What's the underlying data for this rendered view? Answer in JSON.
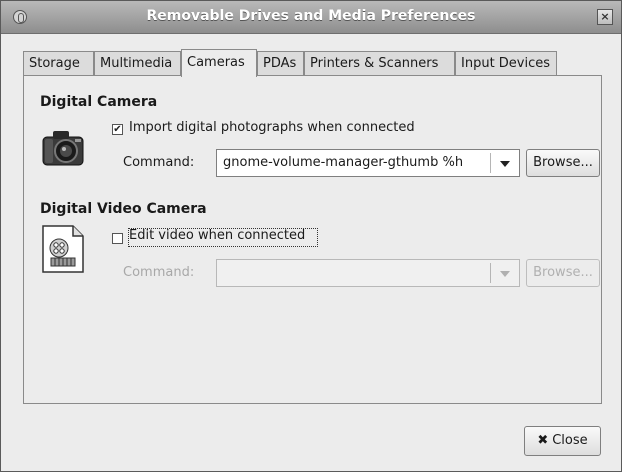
{
  "window": {
    "title": "Removable Drives and Media Preferences",
    "close_glyph": "×"
  },
  "tabs": [
    {
      "label": "Storage",
      "active": false
    },
    {
      "label": "Multimedia",
      "active": false
    },
    {
      "label": "Cameras",
      "active": true
    },
    {
      "label": "PDAs",
      "active": false
    },
    {
      "label": "Printers & Scanners",
      "active": false
    },
    {
      "label": "Input Devices",
      "active": false
    }
  ],
  "digital_camera": {
    "heading": "Digital Camera",
    "icon": "camera-icon",
    "checkbox_label": "Import digital photographs when connected",
    "checkbox_checked": true,
    "check_glyph": "✔",
    "command_label": "Command:",
    "command_value": "gnome-volume-manager-gthumb %h",
    "browse_label": "Browse..."
  },
  "digital_video_camera": {
    "heading": "Digital Video Camera",
    "icon": "film-document-icon",
    "checkbox_label": "Edit video when connected",
    "checkbox_checked": false,
    "command_label": "Command:",
    "command_value": "",
    "browse_label": "Browse..."
  },
  "close_button": {
    "label": "Close",
    "icon": "x-icon",
    "glyph": "✖"
  }
}
